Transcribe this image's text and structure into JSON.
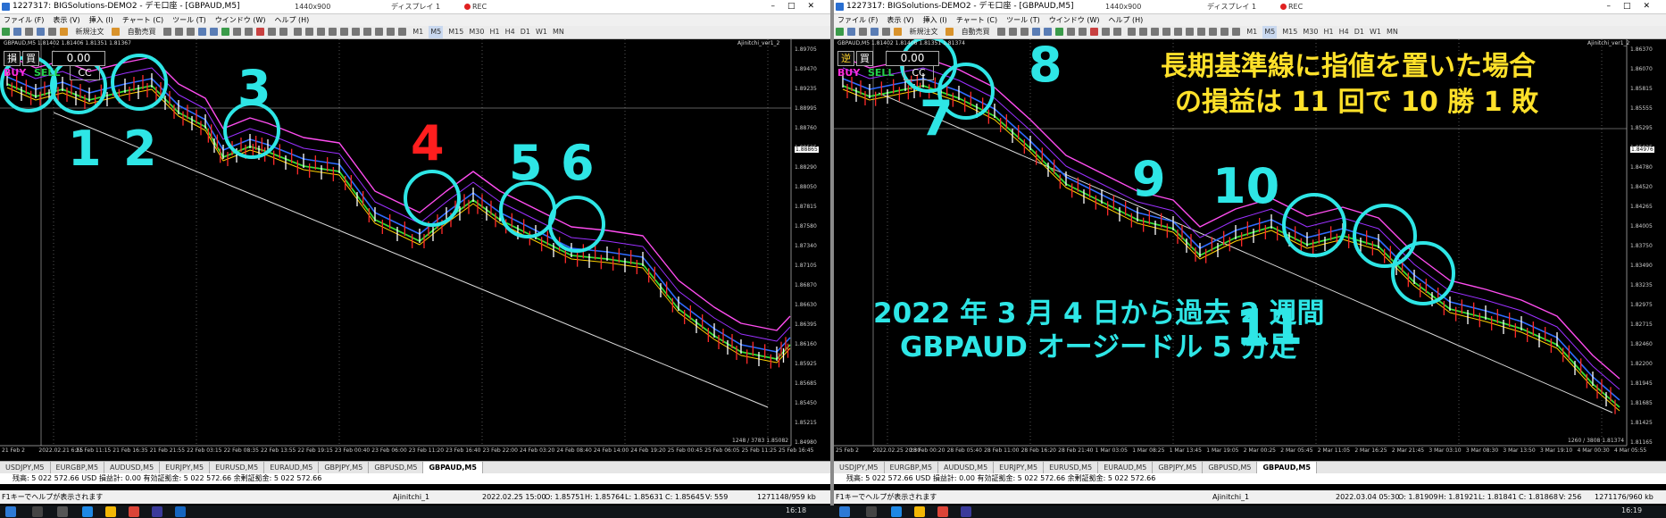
{
  "left": {
    "window_title": "1227317: BIGSolutions-DEMO2 - デモ口座 - [GBPAUD,M5]",
    "resolution": "1440x900",
    "display": "ディスプレイ 1",
    "rec": "REC",
    "menu": [
      "ファイル (F)",
      "表示 (V)",
      "挿入 (I)",
      "チャート (C)",
      "ツール (T)",
      "ウインドウ (W)",
      "ヘルプ (H)"
    ],
    "toolbar": {
      "new_order": "新規注文",
      "auto_trade": "自動売買"
    },
    "timeframes": [
      "M1",
      "M5",
      "M15",
      "M30",
      "H1",
      "H4",
      "D1",
      "W1",
      "MN"
    ],
    "active_tf": "M5",
    "symbol_info": "GBPAUD,M5 1.81402 1.81406 1.81351 1.81367",
    "ea_label": "Ajinitchi_ver1_2",
    "trade_panel": {
      "first_btn": "損",
      "second_btn": "買",
      "lot": "0.00",
      "buy": "BUY",
      "sell": "SELL",
      "cc": "CC"
    },
    "price_axis": [
      "1.89705",
      "1.89470",
      "1.89235",
      "1.88995",
      "1.88760",
      "1.88525",
      "1.88290",
      "1.88050",
      "1.87815",
      "1.87580",
      "1.87340",
      "1.87105",
      "1.86870",
      "1.86630",
      "1.86395",
      "1.86160",
      "1.85925",
      "1.85685",
      "1.85450",
      "1.85215",
      "1.84980"
    ],
    "current_price": "1.88865",
    "time_axis": [
      "21 Feb 2",
      "2022.02.21 6:55",
      "21 Feb 11:15",
      "21 Feb 16:35",
      "21 Feb 21:55",
      "22 Feb 03:15",
      "22 Feb 08:35",
      "22 Feb 13:55",
      "22 Feb 19:15",
      "23 Feb 00:40",
      "23 Feb 06:00",
      "23 Feb 11:20",
      "23 Feb 16:40",
      "23 Feb 22:00",
      "24 Feb 03:20",
      "24 Feb 08:40",
      "24 Feb 14:00",
      "24 Feb 19:20",
      "25 Feb 00:45",
      "25 Feb 06:05",
      "25 Feb 11:25",
      "25 Feb 16:45"
    ],
    "corner_info": "1248 / 3783",
    "last_price_label": "1.85082",
    "numbers": [
      "1",
      "2",
      "3",
      "4",
      "5",
      "6"
    ],
    "tabs": [
      "USDJPY,M5",
      "EURGBP,M5",
      "AUDUSD,M5",
      "EURJPY,M5",
      "EURUSD,M5",
      "EURAUD,M5",
      "GBPJPY,M5",
      "GBPUSD,M5",
      "GBPAUD,M5"
    ],
    "active_tab": "GBPAUD,M5",
    "account": "残高: 5 022 572.66 USD  損益計: 0.00  有効証拠金: 5 022 572.66  余剰証拠金: 5 022 572.66",
    "status": {
      "help": "F1キーでヘルプが表示されます",
      "profile": "Ajinitchi_1",
      "datetime": "2022.02.25 15:00",
      "o": "O: 1.85751",
      "h": "H: 1.85764",
      "l": "L: 1.85631",
      "c": "C: 1.85645",
      "v": "V: 559",
      "traffic": "1271148/959 kb"
    }
  },
  "right": {
    "window_title": "1227317: BIGSolutions-DEMO2 - デモ口座 - [GBPAUD,M5]",
    "resolution": "1440x900",
    "display": "ディスプレイ 1",
    "rec": "REC",
    "menu": [
      "ファイル (F)",
      "表示 (V)",
      "挿入 (I)",
      "チャート (C)",
      "ツール (T)",
      "ウインドウ (W)",
      "ヘルプ (H)"
    ],
    "toolbar": {
      "new_order": "新規注文",
      "auto_trade": "自動売買"
    },
    "timeframes": [
      "M1",
      "M5",
      "M15",
      "M30",
      "H1",
      "H4",
      "D1",
      "W1",
      "MN"
    ],
    "active_tf": "M5",
    "symbol_info": "GBPAUD,M5 1.81402 1.81406 1.81351 1.81374",
    "ea_label": "Ajinitchi_ver1_2",
    "trade_panel": {
      "first_btn": "逆",
      "second_btn": "買",
      "lot": "0.00",
      "buy": "BUY",
      "sell": "SELL",
      "cc": "CC"
    },
    "price_axis": [
      "1.86370",
      "1.86070",
      "1.85815",
      "1.85555",
      "1.85295",
      "1.85035",
      "1.84780",
      "1.84520",
      "1.84265",
      "1.84005",
      "1.83750",
      "1.83490",
      "1.83235",
      "1.82975",
      "1.82715",
      "1.82460",
      "1.82200",
      "1.81945",
      "1.81685",
      "1.81425",
      "1.81165"
    ],
    "current_price": "1.84976",
    "time_axis": [
      "25 Feb 2",
      "2022.02.25 20:30",
      "28 Feb 00:20",
      "28 Feb 05:40",
      "28 Feb 11:00",
      "28 Feb 16:20",
      "28 Feb 21:40",
      "1 Mar 03:05",
      "1 Mar 08:25",
      "1 Mar 13:45",
      "1 Mar 19:05",
      "2 Mar 00:25",
      "2 Mar 05:45",
      "2 Mar 11:05",
      "2 Mar 16:25",
      "2 Mar 21:45",
      "3 Mar 03:10",
      "3 Mar 08:30",
      "3 Mar 13:50",
      "3 Mar 19:10",
      "4 Mar 00:30",
      "4 Mar 05:55"
    ],
    "corner_info": "1260 / 3808",
    "last_price_label": "1.81374",
    "numbers": [
      "7",
      "8",
      "9",
      "10",
      "11"
    ],
    "title_line1": "長期基準線に指値を置いた場合",
    "title_line2": "の損益は 11 回で 10 勝 1 敗",
    "sub_line1": "2022 年 3 月 4 日から過去 2 週間",
    "sub_line2": "GBPAUD オージードル 5 分足",
    "tabs": [
      "USDJPY,M5",
      "EURGBP,M5",
      "AUDUSD,M5",
      "EURJPY,M5",
      "EURUSD,M5",
      "EURAUD,M5",
      "GBPJPY,M5",
      "GBPUSD,M5",
      "GBPAUD,M5"
    ],
    "active_tab": "GBPAUD,M5",
    "account": "残高: 5 022 572.66 USD  損益計: 0.00  有効証拠金: 5 022 572.66  余剰証拠金: 5 022 572.66",
    "status": {
      "help": "F1キーでヘルプが表示されます",
      "profile": "Ajinitchi_1",
      "datetime": "2022.03.04 05:30",
      "o": "O: 1.81909",
      "h": "H: 1.81921",
      "l": "L: 1.81841",
      "c": "C: 1.81868",
      "v": "V: 256",
      "traffic": "1271176/960 kb"
    }
  },
  "taskbar": {
    "time_left": "16:18",
    "time_right": "16:19"
  },
  "colors": {
    "cyan": "#2ee6e6",
    "red": "#ff1e1e",
    "yellow": "#ffe12a",
    "magenta": "#ff4df0",
    "green": "#34e034",
    "blue": "#2f6bff"
  }
}
